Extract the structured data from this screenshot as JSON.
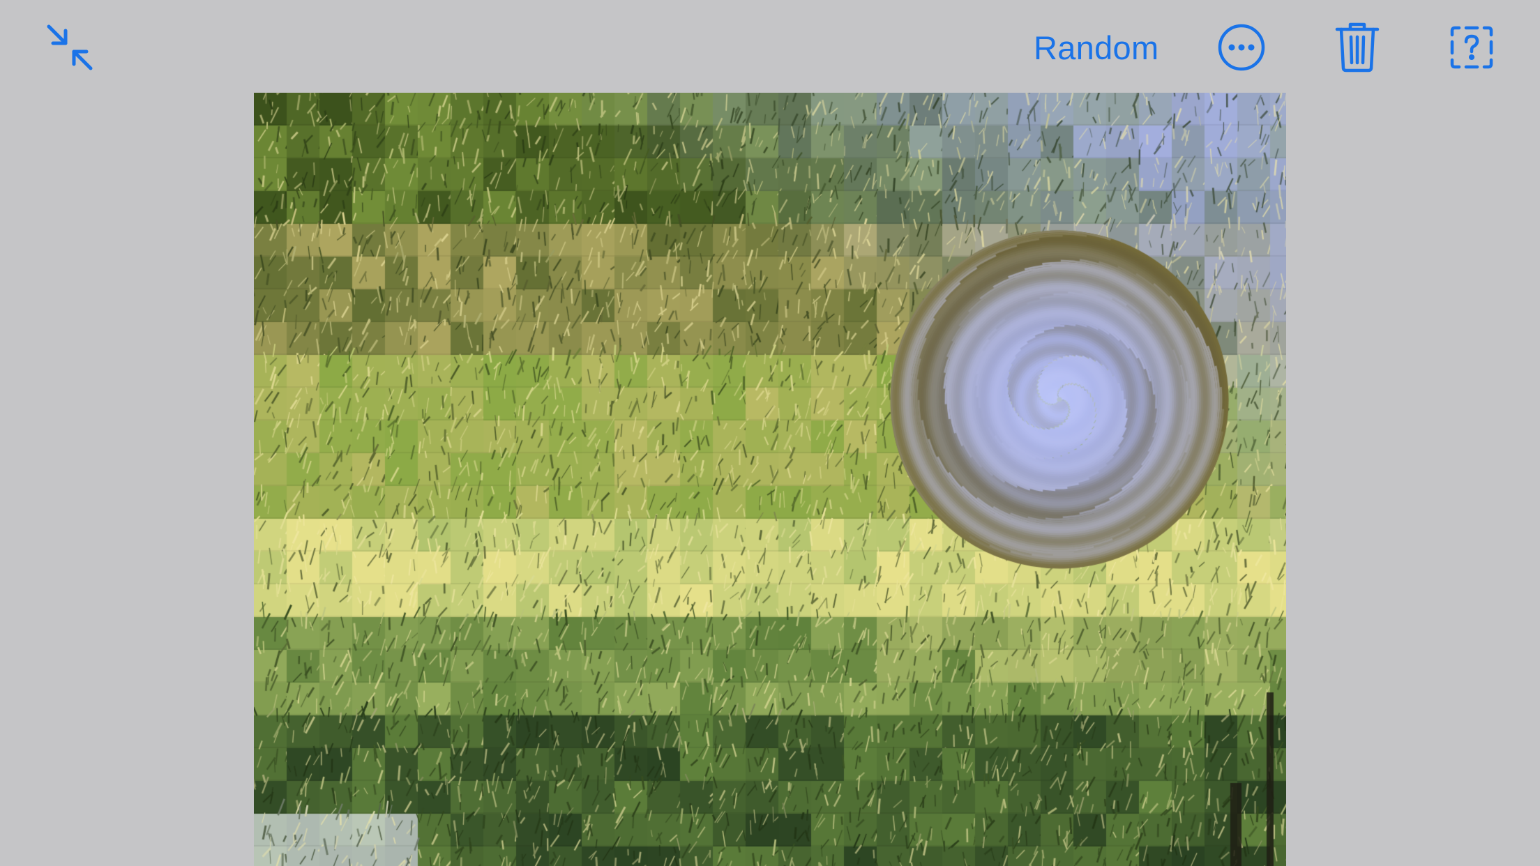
{
  "toolbar": {
    "random_label": "Random",
    "icons": {
      "collapse": "collapse-arrows-icon",
      "more": "ellipsis-circle-icon",
      "trash": "trash-icon",
      "help": "dashed-question-square-icon"
    }
  },
  "colors": {
    "background": "#c5c5c7",
    "accent": "#1a73e8"
  },
  "artwork": {
    "effect": "tile-mosaic-with-swirl",
    "subject": "grass-field-under-sky"
  }
}
